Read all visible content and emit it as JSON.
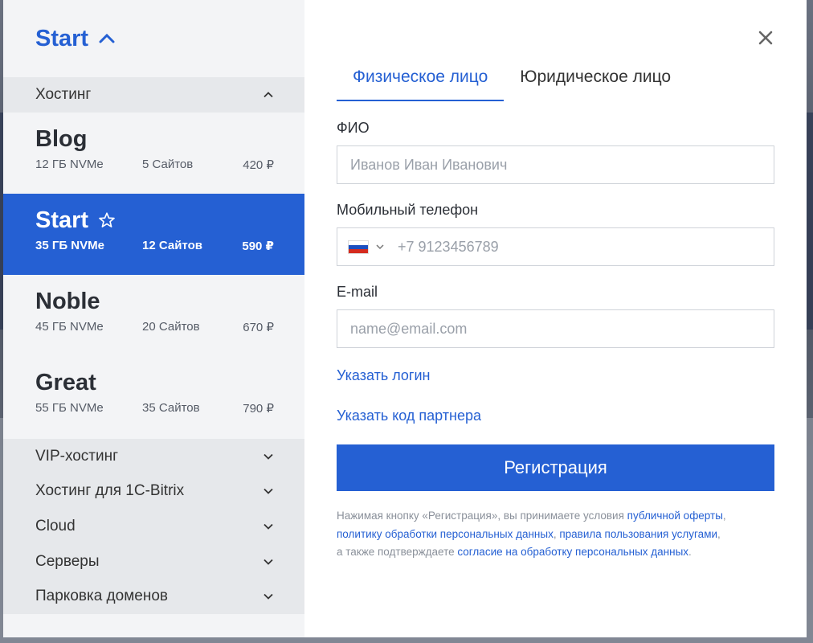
{
  "sidebar": {
    "title": "Start",
    "groups": {
      "hosting": {
        "label": "Хостинг"
      },
      "vip": {
        "label": "VIP-хостинг"
      },
      "bitrix": {
        "label": "Хостинг для 1C-Bitrix"
      },
      "cloud": {
        "label": "Cloud"
      },
      "servers": {
        "label": "Серверы"
      },
      "parking": {
        "label": "Парковка доменов"
      }
    },
    "plans": [
      {
        "name": "Blog",
        "storage": "12 ГБ NVMe",
        "sites": "5 Сайтов",
        "price": "420 ₽"
      },
      {
        "name": "Start",
        "storage": "35 ГБ NVMe",
        "sites": "12 Сайтов",
        "price": "590 ₽"
      },
      {
        "name": "Noble",
        "storage": "45 ГБ NVMe",
        "sites": "20 Сайтов",
        "price": "670 ₽"
      },
      {
        "name": "Great",
        "storage": "55 ГБ NVMe",
        "sites": "35 Сайтов",
        "price": "790 ₽"
      }
    ]
  },
  "form": {
    "tabs": [
      {
        "label": "Физическое лицо"
      },
      {
        "label": "Юридическое лицо"
      }
    ],
    "fio_label": "ФИО",
    "fio_placeholder": "Иванов Иван Иванович",
    "phone_label": "Мобильный телефон",
    "phone_placeholder": "+7 9123456789",
    "email_label": "E-mail",
    "email_placeholder": "name@email.com",
    "login_link": "Указать логин",
    "partner_link": "Указать код партнера",
    "submit_label": "Регистрация",
    "legal": {
      "t1": "Нажимая кнопку «Регистрация», вы принимаете условия ",
      "l1": "публичной оферты",
      "t2": ",",
      "l2": "политику обработки персональных данных",
      "t3": ", ",
      "l3": "правила пользования услугами",
      "t4": ",",
      "t5": "а также подтверждаете ",
      "l4": "согласие на обработку персональных данных",
      "t6": "."
    }
  },
  "icons": {
    "close": "close-icon",
    "chevron_up": "chevron-up-icon",
    "chevron_down": "chevron-down-icon",
    "star": "star-icon",
    "flag": "russia-flag-icon"
  },
  "colors": {
    "accent": "#2560d3",
    "sidebar_bg": "#f3f4f6",
    "group_bg": "#e6e8eb"
  }
}
